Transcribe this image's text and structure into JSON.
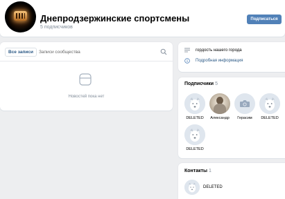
{
  "header": {
    "title": "Днепродзержинские спортсмены",
    "subscribers": "5 подписчиков",
    "subscribe_label": "Подписаться"
  },
  "wall": {
    "tab_all": "Все записи",
    "tab_community": "Записи сообщества",
    "empty_text": "Новостей пока нет"
  },
  "info": {
    "status": "гордость нашего города",
    "details_link": "Подробная информация"
  },
  "members": {
    "title": "Подписчики",
    "count": "5",
    "items": [
      {
        "name": "DELETED",
        "icon": "deleted-dog-avatar"
      },
      {
        "name": "Александр",
        "icon": "photo-avatar"
      },
      {
        "name": "Герасим",
        "icon": "camera-icon"
      },
      {
        "name": "DELETED",
        "icon": "deleted-dog-avatar"
      },
      {
        "name": "DELETED",
        "icon": "deleted-dog-avatar"
      }
    ]
  },
  "contacts": {
    "title": "Контакты",
    "count": "1",
    "items": [
      {
        "name": "DELETED",
        "icon": "deleted-dog-avatar"
      }
    ]
  },
  "colors": {
    "accent": "#5181b8",
    "link": "#2a5885",
    "background": "#edeef0",
    "muted_text": "#818c99"
  }
}
